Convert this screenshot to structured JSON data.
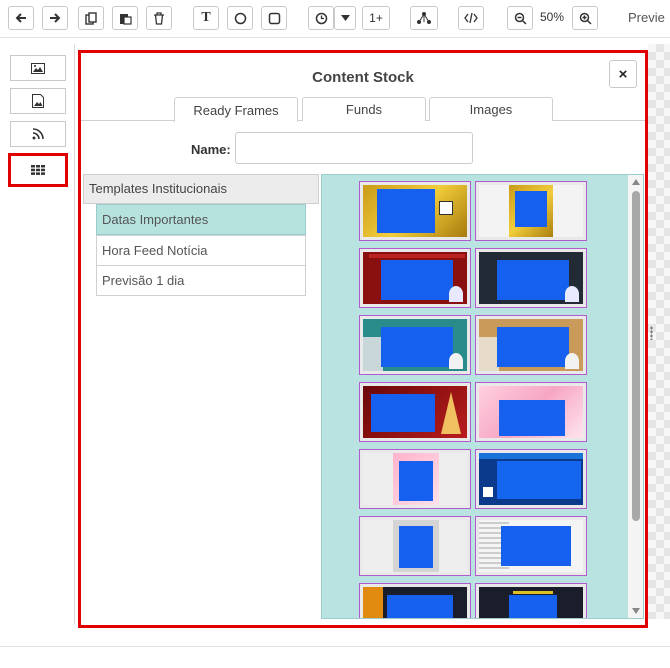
{
  "toolbar": {
    "zoom_value": "50%",
    "preview_label": "Previe",
    "text_tool_label": "T",
    "one_plus_label": "1+"
  },
  "modal": {
    "title": "Content Stock",
    "close_label": "×",
    "tabs": [
      {
        "label": "Ready Frames",
        "active": true
      },
      {
        "label": "Funds",
        "active": false
      },
      {
        "label": "Images",
        "active": false
      }
    ],
    "name_label": "Name:",
    "name_value": "",
    "category_header": "Templates Institucionais",
    "categories": [
      {
        "label": "Datas Importantes",
        "selected": true
      },
      {
        "label": "Hora Feed Notícia",
        "selected": false
      },
      {
        "label": "Previsão 1 dia",
        "selected": false
      }
    ]
  },
  "thumbnails": [
    {
      "name": "gold-frame-1"
    },
    {
      "name": "gold-frame-2"
    },
    {
      "name": "red-christmas-1"
    },
    {
      "name": "dark-christmas-1"
    },
    {
      "name": "teal-frame"
    },
    {
      "name": "beige-frame"
    },
    {
      "name": "christmas-tree"
    },
    {
      "name": "pink-frame-1"
    },
    {
      "name": "pink-portrait"
    },
    {
      "name": "blue-wide-frame"
    },
    {
      "name": "grey-portrait"
    },
    {
      "name": "newspaper-frame"
    },
    {
      "name": "dark-partial-1"
    },
    {
      "name": "dark-partial-2"
    }
  ],
  "colors": {
    "highlight_red": "#e10000",
    "selected_category": "#b7e3df",
    "panel_bg": "#b8e3e0",
    "thumb_border": "#b05ccf",
    "screen_blue": "#1660f0"
  }
}
